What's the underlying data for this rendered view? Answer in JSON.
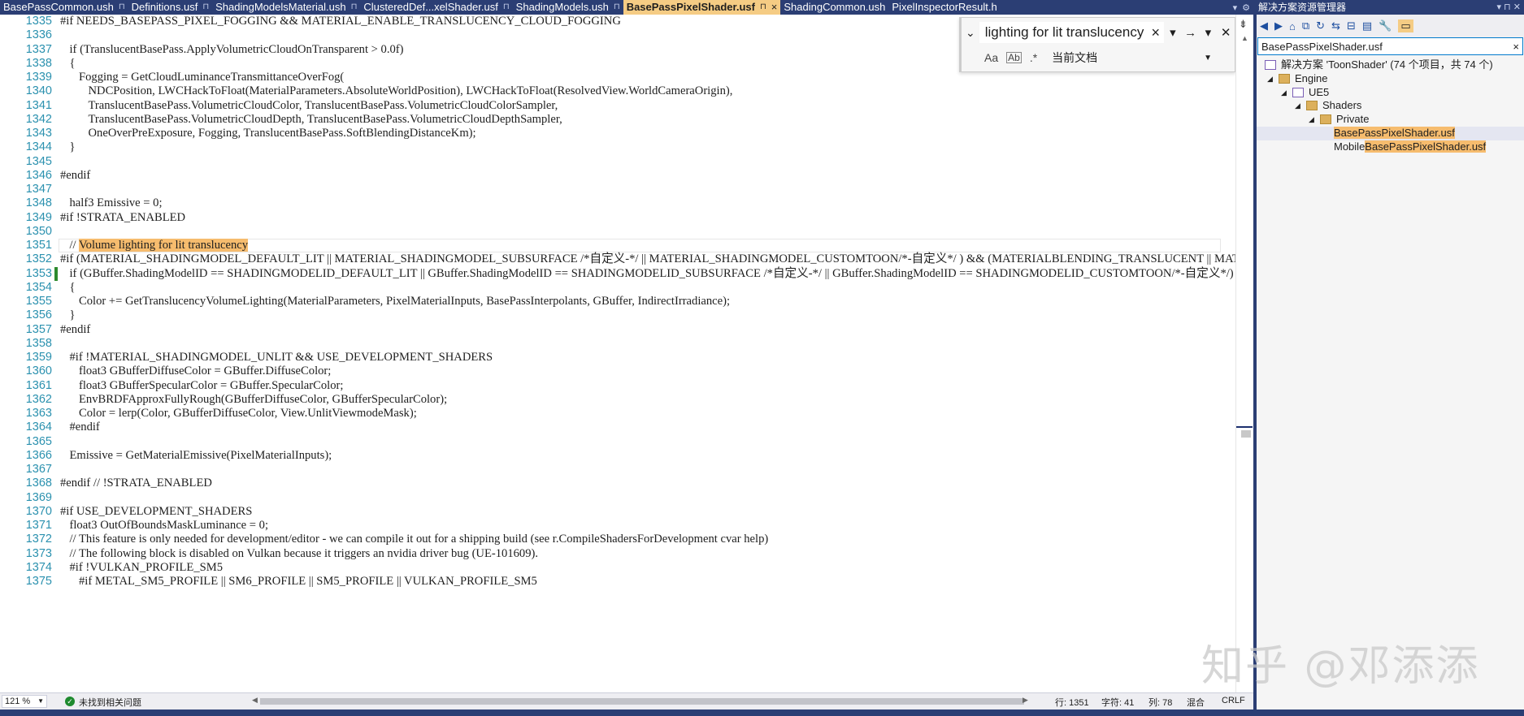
{
  "tabs": [
    {
      "label": "BasePassCommon.ush",
      "pinned": true,
      "active": false
    },
    {
      "label": "Definitions.usf",
      "pinned": true,
      "active": false
    },
    {
      "label": "ShadingModelsMaterial.ush",
      "pinned": true,
      "active": false
    },
    {
      "label": "ClusteredDef...xelShader.usf",
      "pinned": true,
      "active": false
    },
    {
      "label": "ShadingModels.ush",
      "pinned": true,
      "active": false
    },
    {
      "label": "BasePassPixelShader.usf",
      "pinned": true,
      "active": true
    },
    {
      "label": "ShadingCommon.ush",
      "pinned": false,
      "active": false
    },
    {
      "label": "PixelInspectorResult.h",
      "pinned": false,
      "active": false
    }
  ],
  "tab_icons": {
    "pin": "pin-icon",
    "close": "close-icon",
    "overflow": "chevron-down-icon",
    "settings": "gear-icon"
  },
  "editor": {
    "lines": [
      {
        "n": "1335",
        "indent": 0,
        "text": "#if NEEDS_BASEPASS_PIXEL_FOGGING && MATERIAL_ENABLE_TRANSLUCENCY_CLOUD_FOGGING"
      },
      {
        "n": "1336",
        "indent": 0,
        "text": ""
      },
      {
        "n": "1337",
        "indent": 1,
        "text": "if (TranslucentBasePass.ApplyVolumetricCloudOnTransparent > 0.0f)"
      },
      {
        "n": "1338",
        "indent": 1,
        "text": "{"
      },
      {
        "n": "1339",
        "indent": 2,
        "text": "Fogging = GetCloudLuminanceTransmittanceOverFog("
      },
      {
        "n": "1340",
        "indent": 3,
        "text": "NDCPosition, LWCHackToFloat(MaterialParameters.AbsoluteWorldPosition), LWCHackToFloat(ResolvedView.WorldCameraOrigin),"
      },
      {
        "n": "1341",
        "indent": 3,
        "text": "TranslucentBasePass.VolumetricCloudColor, TranslucentBasePass.VolumetricCloudColorSampler,"
      },
      {
        "n": "1342",
        "indent": 3,
        "text": "TranslucentBasePass.VolumetricCloudDepth, TranslucentBasePass.VolumetricCloudDepthSampler,"
      },
      {
        "n": "1343",
        "indent": 3,
        "text": "OneOverPreExposure, Fogging, TranslucentBasePass.SoftBlendingDistanceKm);"
      },
      {
        "n": "1344",
        "indent": 1,
        "text": "}"
      },
      {
        "n": "1345",
        "indent": 0,
        "text": ""
      },
      {
        "n": "1346",
        "indent": 0,
        "text": "#endif"
      },
      {
        "n": "1347",
        "indent": 0,
        "text": ""
      },
      {
        "n": "1348",
        "indent": 1,
        "text": "half3 Emissive = 0;"
      },
      {
        "n": "1349",
        "indent": 0,
        "text": "#if !STRATA_ENABLED"
      },
      {
        "n": "1350",
        "indent": 0,
        "text": ""
      },
      {
        "n": "1351",
        "indent": 1,
        "text": "// ",
        "highlight": "Volume lighting for lit translucency"
      },
      {
        "n": "1352",
        "indent": 0,
        "text": "#if (MATERIAL_SHADINGMODEL_DEFAULT_LIT || MATERIAL_SHADINGMODEL_SUBSURFACE /*自定义-*/ || MATERIAL_SHADINGMODEL_CUSTOMTOON/*-自定义*/ ) && (MATERIALBLENDING_TRANSLUCENT || MATERIALBLENDING_ADDITIVE)"
      },
      {
        "n": "1353",
        "indent": 1,
        "text": "if (GBuffer.ShadingModelID == SHADINGMODELID_DEFAULT_LIT || GBuffer.ShadingModelID == SHADINGMODELID_SUBSURFACE /*自定义-*/ || GBuffer.ShadingModelID == SHADINGMODELID_CUSTOMTOON/*-自定义*/)",
        "changed": true
      },
      {
        "n": "1354",
        "indent": 1,
        "text": "{"
      },
      {
        "n": "1355",
        "indent": 2,
        "text": "Color += GetTranslucencyVolumeLighting(MaterialParameters, PixelMaterialInputs, BasePassInterpolants, GBuffer, IndirectIrradiance);"
      },
      {
        "n": "1356",
        "indent": 1,
        "text": "}"
      },
      {
        "n": "1357",
        "indent": 0,
        "text": "#endif"
      },
      {
        "n": "1358",
        "indent": 0,
        "text": ""
      },
      {
        "n": "1359",
        "indent": 1,
        "text": "#if !MATERIAL_SHADINGMODEL_UNLIT && USE_DEVELOPMENT_SHADERS"
      },
      {
        "n": "1360",
        "indent": 2,
        "text": "float3 GBufferDiffuseColor = GBuffer.DiffuseColor;"
      },
      {
        "n": "1361",
        "indent": 2,
        "text": "float3 GBufferSpecularColor = GBuffer.SpecularColor;"
      },
      {
        "n": "1362",
        "indent": 2,
        "text": "EnvBRDFApproxFullyRough(GBufferDiffuseColor, GBufferSpecularColor);"
      },
      {
        "n": "1363",
        "indent": 2,
        "text": "Color = lerp(Color, GBufferDiffuseColor, View.UnlitViewmodeMask);"
      },
      {
        "n": "1364",
        "indent": 1,
        "text": "#endif"
      },
      {
        "n": "1365",
        "indent": 0,
        "text": ""
      },
      {
        "n": "1366",
        "indent": 1,
        "text": "Emissive = GetMaterialEmissive(PixelMaterialInputs);"
      },
      {
        "n": "1367",
        "indent": 0,
        "text": ""
      },
      {
        "n": "1368",
        "indent": 0,
        "text": "#endif // !STRATA_ENABLED"
      },
      {
        "n": "1369",
        "indent": 0,
        "text": ""
      },
      {
        "n": "1370",
        "indent": 0,
        "text": "#if USE_DEVELOPMENT_SHADERS"
      },
      {
        "n": "1371",
        "indent": 1,
        "text": "float3 OutOfBoundsMaskLuminance = 0;"
      },
      {
        "n": "1372",
        "indent": 1,
        "text": "// This feature is only needed for development/editor - we can compile it out for a shipping build (see r.CompileShadersForDevelopment cvar help)"
      },
      {
        "n": "1373",
        "indent": 1,
        "text": "// The following block is disabled on Vulkan because it triggers an nvidia driver bug (UE-101609)."
      },
      {
        "n": "1374",
        "indent": 1,
        "text": "#if !VULKAN_PROFILE_SM5"
      },
      {
        "n": "1375",
        "indent": 2,
        "text": "#if METAL_SM5_PROFILE || SM6_PROFILE || SM5_PROFILE || VULKAN_PROFILE_SM5"
      }
    ]
  },
  "find": {
    "query": "lighting for lit translucency",
    "scope": "当前文档",
    "icons": {
      "expand": "chevron-down-icon",
      "clear": "close-icon",
      "history": "dropdown-arrow-icon",
      "next": "arrow-right-icon",
      "options": "chevron-down-icon",
      "close": "close-icon",
      "match_case": "match-case-icon",
      "whole_word": "whole-word-icon",
      "regex": "regex-icon"
    },
    "opt_labels": {
      "match_case": "Aa",
      "whole_word": "Ab",
      "regex": ".*"
    }
  },
  "status": {
    "zoom": "121 %",
    "issues": "未找到相关问题",
    "line": "行: 1351",
    "char": "字符: 41",
    "col": "列: 78",
    "mode": "混合",
    "eol": "CRLF"
  },
  "solution_explorer": {
    "title": "解决方案资源管理器",
    "search_value": "BasePassPixelShader.usf",
    "tree": [
      {
        "depth": 0,
        "twisty": "",
        "icon": "solution-icon",
        "label": "解决方案 'ToonShader' (74 个项目，共 74 个)"
      },
      {
        "depth": 1,
        "twisty": "◢",
        "icon": "folder-icon",
        "label": "Engine"
      },
      {
        "depth": 2,
        "twisty": "◢",
        "icon": "project-icon",
        "label": "UE5"
      },
      {
        "depth": 3,
        "twisty": "◢",
        "icon": "filter-folder-icon",
        "label": "Shaders"
      },
      {
        "depth": 4,
        "twisty": "◢",
        "icon": "filter-folder-icon",
        "label": "Private"
      },
      {
        "depth": 5,
        "twisty": "",
        "icon": "",
        "prefix": "",
        "match": "BasePassPixelShader.usf",
        "selected": true
      },
      {
        "depth": 5,
        "twisty": "",
        "icon": "",
        "prefix": "Mobile",
        "match": "BasePassPixelShader.usf",
        "selected": false
      }
    ]
  },
  "watermark": "知乎 @邓添添",
  "colors": {
    "tab_bar": "#2b3e74",
    "active_tab": "#f5cc84",
    "line_number": "#2b91af",
    "find_highlight": "#f6bc6e",
    "change_marker": "#2d8a2d"
  }
}
